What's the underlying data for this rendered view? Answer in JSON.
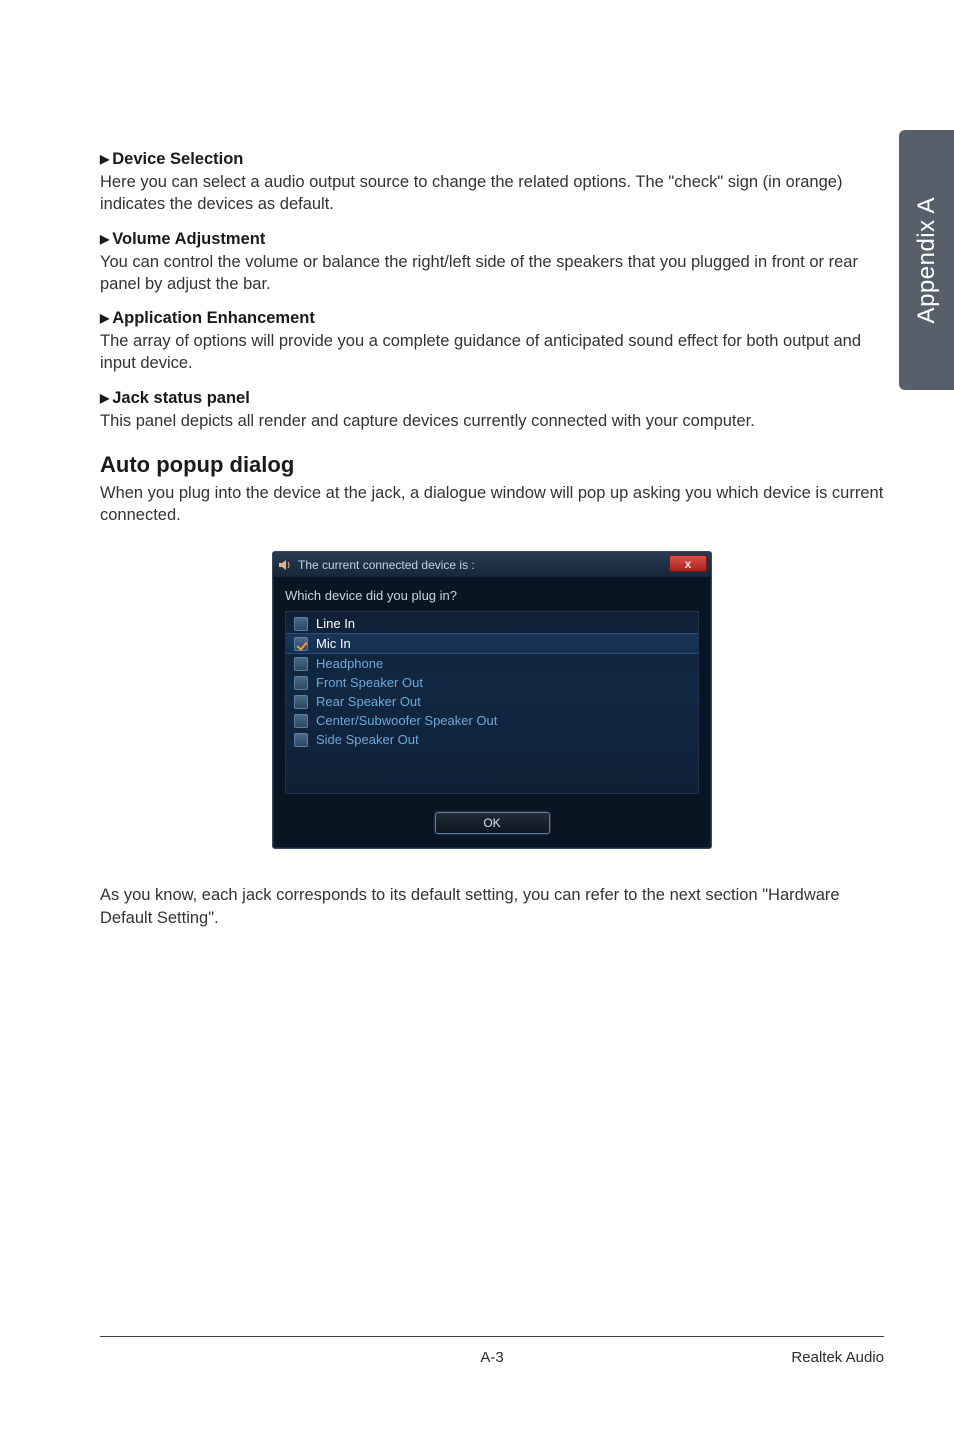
{
  "sideTab": "Appendix A",
  "sections": [
    {
      "title": "Device Selection",
      "body": "Here you can select a audio output source to change the related options. The \"check\" sign (in orange) indicates the devices as default."
    },
    {
      "title": "Volume Adjustment",
      "body": "You can control the volume or balance the right/left side of the speakers that you plugged in front or rear panel by adjust the bar."
    },
    {
      "title": "Application Enhancement",
      "body": "The array of options will provide you a complete guidance of anticipated sound effect for both output and input device."
    },
    {
      "title": "Jack status panel",
      "body": "This panel depicts all render and capture devices currently connected with your computer."
    }
  ],
  "autoPopup": {
    "heading": "Auto popup dialog",
    "intro": "When you plug into the device at the jack, a dialogue window will pop up asking you which device is current connected."
  },
  "dialog": {
    "title": "The current connected device is :",
    "closeGlyph": "x",
    "prompt": "Which device did you plug in?",
    "items": [
      {
        "label": "Line In",
        "selected": false,
        "white": true
      },
      {
        "label": "Mic In",
        "selected": true,
        "white": true
      },
      {
        "label": "Headphone",
        "selected": false,
        "white": false
      },
      {
        "label": "Front Speaker Out",
        "selected": false,
        "white": false
      },
      {
        "label": "Rear Speaker Out",
        "selected": false,
        "white": false
      },
      {
        "label": "Center/Subwoofer Speaker Out",
        "selected": false,
        "white": false
      },
      {
        "label": "Side Speaker Out",
        "selected": false,
        "white": false
      }
    ],
    "okLabel": "OK"
  },
  "afterDialog": "As you know, each jack corresponds to its default setting, you can refer to the next section \"Hardware Default Setting\".",
  "footer": {
    "pageNum": "A-3",
    "right": "Realtek Audio"
  }
}
